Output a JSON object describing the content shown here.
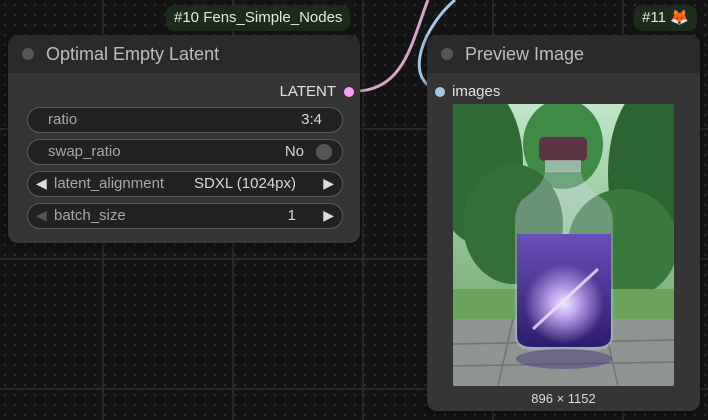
{
  "badges": {
    "node10": "#10 Fens_Simple_Nodes",
    "node11": "#11 🦊"
  },
  "latent_node": {
    "title": "Optimal Empty Latent",
    "output_label": "LATENT",
    "widgets": {
      "ratio": {
        "label": "ratio",
        "value": "3:4"
      },
      "swap_ratio": {
        "label": "swap_ratio",
        "value": "No"
      },
      "latent_alignment": {
        "label": "latent_alignment",
        "value": "SDXL (1024px)"
      },
      "batch_size": {
        "label": "batch_size",
        "value": "1"
      }
    }
  },
  "preview_node": {
    "title": "Preview Image",
    "input_label": "images",
    "image_caption": "896 × 1152"
  },
  "colors": {
    "latent_link": "#d8a5c8",
    "image_link": "#a6c8e8",
    "canvas": "#141414",
    "node_body": "#353535",
    "node_title": "#2a2a2a"
  }
}
